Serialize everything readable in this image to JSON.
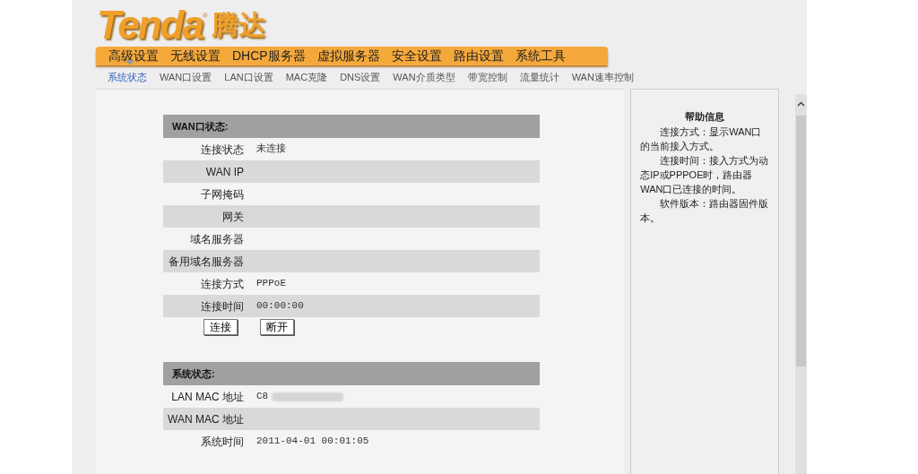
{
  "logo": {
    "brand": "Tenda",
    "mark": "®",
    "name_cn": "腾达"
  },
  "main_nav": [
    "高级设置",
    "无线设置",
    "DHCP服务器",
    "虚拟服务器",
    "安全设置",
    "路由设置",
    "系统工具"
  ],
  "sub_nav": [
    {
      "label": "系统状态",
      "selected": true
    },
    {
      "label": "WAN口设置",
      "selected": false
    },
    {
      "label": "LAN口设置",
      "selected": false
    },
    {
      "label": "MAC克隆",
      "selected": false
    },
    {
      "label": "DNS设置",
      "selected": false
    },
    {
      "label": "WAN介质类型",
      "selected": false
    },
    {
      "label": "带宽控制",
      "selected": false
    },
    {
      "label": "流量统计",
      "selected": false
    },
    {
      "label": "WAN速率控制",
      "selected": false
    }
  ],
  "sections": [
    {
      "title": "WAN口状态:",
      "rows": [
        {
          "label": "连接状态",
          "value": "未连接"
        },
        {
          "label": "WAN IP"
        },
        {
          "label": "子网掩码"
        },
        {
          "label": "网关"
        },
        {
          "label": "域名服务器"
        },
        {
          "label": "备用域名服务器"
        },
        {
          "label": "连接方式",
          "value": "PPPoE"
        },
        {
          "label": "连接时间",
          "value": "00:00:00"
        }
      ],
      "buttons": [
        "连接",
        "断开"
      ]
    },
    {
      "title": "系统状态:",
      "rows": [
        {
          "label": "LAN MAC 地址",
          "value": "C8",
          "blurred": true
        },
        {
          "label": "WAN MAC 地址"
        },
        {
          "label": "系统时间",
          "value": "2011-04-01 00:01:05"
        }
      ]
    }
  ],
  "help": {
    "title": "帮助信息",
    "paragraphs": [
      "连接方式：显示WAN口的当前接入方式。",
      "连接时间：接入方式为动态IP或PPPOE时，路由器WAN口已连接的时间。",
      "软件版本：路由器固件版本。"
    ]
  }
}
